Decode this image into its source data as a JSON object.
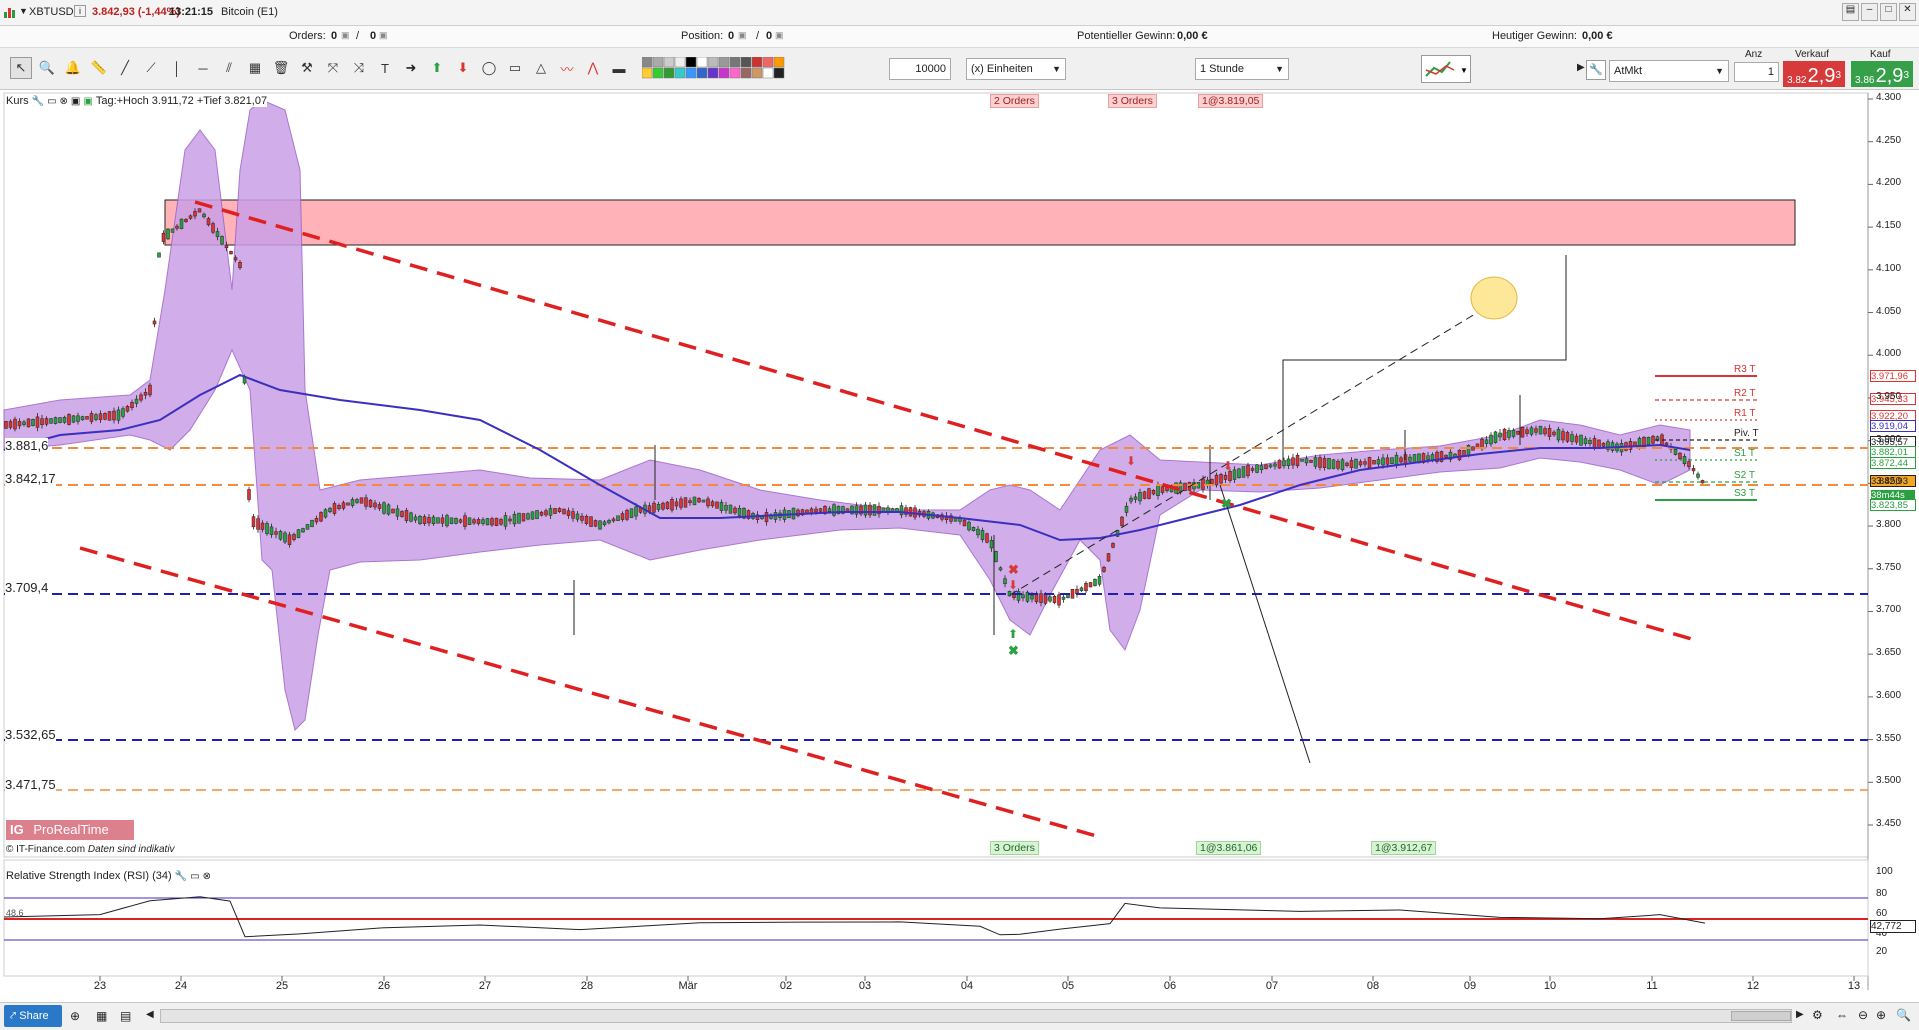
{
  "header": {
    "symbol": "XBTUSD",
    "price_change": "3.842,93 (-1,44%)",
    "time": "13:21:15",
    "instrument_name": "Bitcoin (E1)"
  },
  "status": {
    "orders_label": "Orders:",
    "orders_value": "0",
    "orders_value2": "0",
    "position_label": "Position:",
    "position_value": "0",
    "position_value2": "0",
    "potential_gain_label": "Potentieller Gewinn:",
    "potential_gain_value": "0,00 €",
    "today_gain_label": "Heutiger Gewinn:",
    "today_gain_value": "0,00 €"
  },
  "toolbar": {
    "quantity_value": "10000",
    "units_select": "(x) Einheiten",
    "timeframe_select": "1 Stunde",
    "order_type_select": "AtMkt",
    "amount_label": "Anz",
    "amount_value": "1",
    "sell_label": "Verkauf",
    "buy_label": "Kauf",
    "sell_price_small": "3.82",
    "sell_price_big": "2,9",
    "sell_price_sup": "3",
    "buy_price_small": "3.86",
    "buy_price_big": "2,9",
    "buy_price_sup": "3"
  },
  "colors": {
    "resistance_zone": "#ffb3b8",
    "bollinger_fill": "#c9a0e6",
    "moving_average": "#3a2fc0",
    "red_trendline": "#e02020",
    "orange_level": "#f08a3c",
    "blue_level": "#2020b0",
    "buy_green": "#2aa040",
    "sell_red": "#d43a3a"
  },
  "price_panel": {
    "legend_title": "Kurs",
    "legend_extra": "Tag:+Hoch 3.911,72 +Tief 3.821,07",
    "copyright": "© IT-Finance.com",
    "disclaimer": "Daten sind indikativ",
    "brand": "ProRealTime",
    "brand_logo": "IG",
    "top_tags": [
      "2 Orders",
      "3 Orders",
      "1@3.819,05"
    ],
    "bottom_tags": [
      "3 Orders",
      "1@3.861,06",
      "1@3.912,67"
    ],
    "left_levels": [
      "3.881,6",
      "3.842,17",
      "3.709,4",
      "3.532,65",
      "3.471,75"
    ],
    "pivot_labels": [
      "R3 T",
      "R2 T",
      "R1 T",
      "Piv. T",
      "S1 T",
      "S2 T",
      "S3 T"
    ],
    "right_tags": [
      "3.971,96",
      "3.945,33",
      "3.922,20",
      "3.919,04",
      "3.895,57",
      "3.882,01",
      "3.872,44",
      "3.842,93",
      "38m44s",
      "3.823,85"
    ],
    "y_axis": [
      "4.300",
      "4.250",
      "4.200",
      "4.150",
      "4.100",
      "4.050",
      "4.000",
      "3.950",
      "3.900",
      "3.850",
      "3.800",
      "3.750",
      "3.700",
      "3.650",
      "3.600",
      "3.550",
      "3.500",
      "3.450"
    ]
  },
  "rsi_panel": {
    "title": "Relative Strength Index (RSI) (34)",
    "left_value": "48,6",
    "current_value": "42,772",
    "y_axis": [
      "100",
      "80",
      "60",
      "40",
      "20"
    ]
  },
  "x_axis": [
    "23",
    "24",
    "25",
    "26",
    "27",
    "28",
    "Mär",
    "02",
    "03",
    "04",
    "05",
    "06",
    "07",
    "08",
    "09",
    "10",
    "11",
    "12",
    "13"
  ],
  "bottom": {
    "share_label": "Share"
  }
}
